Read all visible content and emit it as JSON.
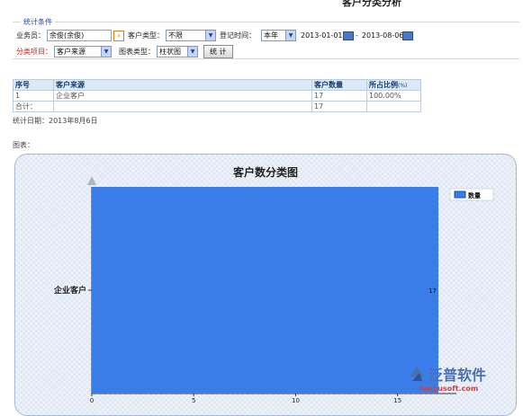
{
  "page_title": "客户分类分析",
  "filters": {
    "legend": "统计条件",
    "salesman_label": "业务员：",
    "salesman_value": "余俊(余俊)",
    "customer_type_label": "客户类型：",
    "customer_type_value": "不限",
    "register_time_label": "登记时间：",
    "period_value": "本年",
    "date_from": "2013-01-01",
    "date_sep": "-",
    "date_to": "2013-08-06",
    "category_label": "分类项目：",
    "category_value": "客户来源",
    "chart_type_label": "图表类型：",
    "chart_type_value": "柱状图",
    "stat_button": "统 计"
  },
  "table": {
    "headers": {
      "no": "序号",
      "source": "客户来源",
      "count": "客户数量",
      "pct": "所占比例",
      "pct_unit": "(%)"
    },
    "rows": [
      {
        "no": "1",
        "source": "企业客户",
        "count": "17",
        "pct": "100.00%"
      }
    ],
    "total": {
      "label": "合计：",
      "count": "17"
    }
  },
  "stat_date": "统计日期：2013年8月6日",
  "chart_caption": "图表：",
  "chart_data": {
    "type": "bar",
    "orientation": "horizontal",
    "title": "客户数分类图",
    "categories": [
      "企业客户"
    ],
    "series": [
      {
        "name": "数量",
        "values": [
          17
        ]
      }
    ],
    "data_labels": [
      "17"
    ],
    "xticks": [
      "0",
      "5",
      "10",
      "15"
    ],
    "xlim": [
      0,
      17
    ],
    "legend_position": "top-right",
    "bar_color": "#3a7de8"
  },
  "watermark": {
    "brand": "泛普软件",
    "url": "fanpusoft.com"
  }
}
